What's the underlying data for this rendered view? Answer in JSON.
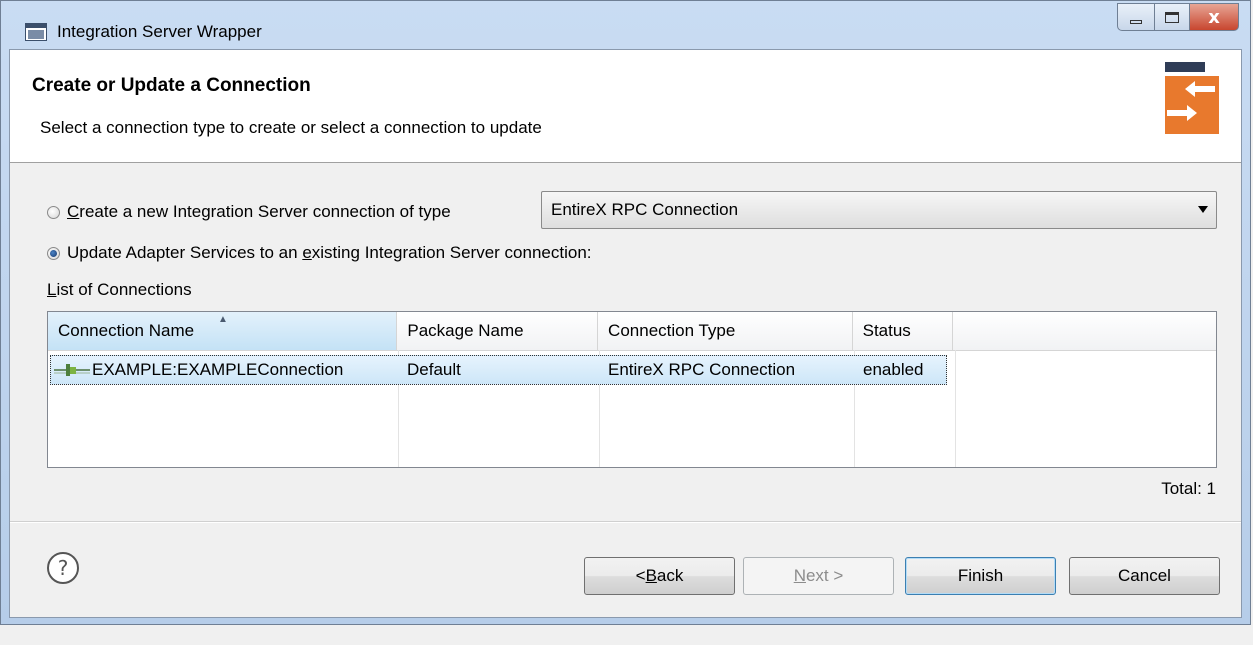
{
  "window": {
    "title": "Integration Server Wrapper"
  },
  "header": {
    "title": "Create or Update a Connection",
    "subtitle": "Select a connection type to create or select a connection to update"
  },
  "options": {
    "create_prefix": "C",
    "create_rest": "reate a new Integration Server connection of type",
    "update_prefix": "Update Adapter Services to an ",
    "update_mnemonic": "e",
    "update_rest": "xisting Integration Server connection:",
    "selected": "update"
  },
  "connection_type": {
    "value": "EntireX RPC Connection"
  },
  "list": {
    "label_mnemonic": "L",
    "label_rest": "ist of Connections",
    "columns": [
      "Connection Name",
      "Package Name",
      "Connection Type",
      "Status"
    ],
    "rows": [
      {
        "name": "EXAMPLE:EXAMPLEConnection",
        "package": "Default",
        "type": "EntireX RPC Connection",
        "status": "enabled"
      }
    ],
    "total": "Total: 1"
  },
  "buttons": {
    "back_prefix": "< ",
    "back_mnemonic": "B",
    "back_rest": "ack",
    "next_mnemonic": "N",
    "next_rest": "ext >",
    "finish": "Finish",
    "cancel": "Cancel"
  },
  "icons": {
    "app": "app-window-icon",
    "logo": "connection-wizard-icon",
    "help": "help-icon",
    "connection": "connection-plug-icon"
  },
  "colors": {
    "accent": "#e8792d",
    "selection": "#cde6f8"
  }
}
